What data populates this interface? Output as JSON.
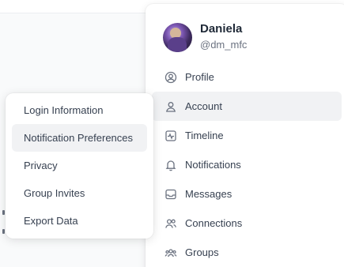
{
  "user": {
    "name": "Daniela",
    "handle": "@dm_mfc"
  },
  "main_menu": {
    "items": [
      {
        "label": "Profile",
        "icon": "user-circle-icon"
      },
      {
        "label": "Account",
        "icon": "user-icon",
        "active": true
      },
      {
        "label": "Timeline",
        "icon": "activity-icon"
      },
      {
        "label": "Notifications",
        "icon": "bell-icon"
      },
      {
        "label": "Messages",
        "icon": "inbox-icon"
      },
      {
        "label": "Connections",
        "icon": "users-icon"
      },
      {
        "label": "Groups",
        "icon": "group-icon"
      }
    ]
  },
  "sub_menu": {
    "items": [
      {
        "label": "Login Information"
      },
      {
        "label": "Notification Preferences",
        "active": true
      },
      {
        "label": "Privacy"
      },
      {
        "label": "Group Invites"
      },
      {
        "label": "Export Data"
      }
    ]
  },
  "colors": {
    "active_bg": "#f1f2f4",
    "text": "#374151",
    "muted": "#6b7280"
  }
}
